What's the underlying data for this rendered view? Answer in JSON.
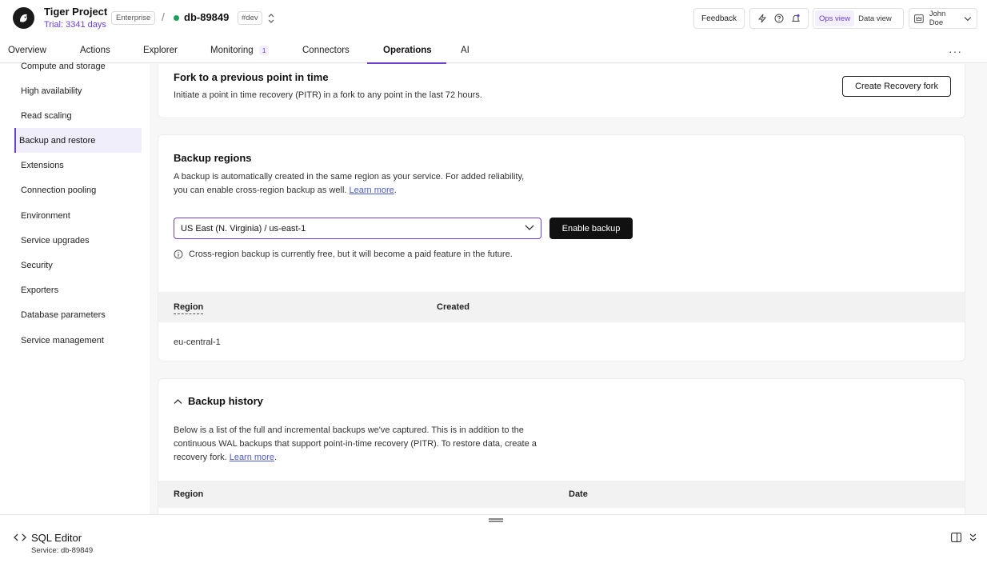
{
  "header": {
    "project_name": "Tiger Project",
    "trial": "Trial: 3341 days",
    "plan_badge": "Enterprise",
    "separator": "/",
    "service_name": "db-89849",
    "env_tag": "#dev",
    "feedback_label": "Feedback",
    "ops_view_label": "Ops view",
    "data_view_label": "Data view",
    "user_name": "John Doe"
  },
  "tabs": [
    {
      "label": "Overview"
    },
    {
      "label": "Actions"
    },
    {
      "label": "Explorer"
    },
    {
      "label": "Monitoring",
      "count": "1"
    },
    {
      "label": "Connectors"
    },
    {
      "label": "Operations"
    },
    {
      "label": "AI"
    }
  ],
  "sidebar": {
    "items": [
      {
        "label": "Compute and storage"
      },
      {
        "label": "High availability"
      },
      {
        "label": "Read scaling"
      },
      {
        "label": "Backup and restore"
      },
      {
        "label": "Extensions"
      },
      {
        "label": "Connection pooling"
      },
      {
        "label": "Environment"
      },
      {
        "label": "Service upgrades"
      },
      {
        "label": "Security"
      },
      {
        "label": "Exporters"
      },
      {
        "label": "Database parameters"
      },
      {
        "label": "Service management"
      }
    ]
  },
  "fork": {
    "title": "Fork to a previous point in time",
    "description": "Initiate a point in time recovery (PITR) in a fork to any point in the last 72 hours.",
    "button_label": "Create Recovery fork"
  },
  "backup_regions": {
    "title": "Backup regions",
    "description_1": "A backup is automatically created in the same region as your service. For added reliability,",
    "description_2": "you can enable cross-region backup as well.",
    "learn_more": "Learn more",
    "period": ".",
    "selected_region": "US East (N. Virginia) / us-east-1",
    "enable_label": "Enable backup",
    "info_text": "Cross-region backup is currently free, but it will become a paid feature in the future.",
    "columns": [
      "Region",
      "Created"
    ],
    "rows": [
      {
        "region": "eu-central-1",
        "created": ""
      }
    ]
  },
  "backup_history": {
    "title": "Backup history",
    "description_1": "Below is a list of the full and incremental backups we've captured. This is in addition to the",
    "description_2": "continuous WAL backups that support point-in-time recovery (PITR). To restore data, create a",
    "description_3": "recovery fork.",
    "learn_more": "Learn more",
    "period": ".",
    "columns": [
      "Region",
      "Date"
    ]
  },
  "sql_editor": {
    "title": "SQL Editor",
    "service": "Service: db-89849"
  },
  "colors": {
    "accent": "#6b3fd4",
    "status_ok": "#1a9e5a",
    "link": "#4a5bd4"
  }
}
